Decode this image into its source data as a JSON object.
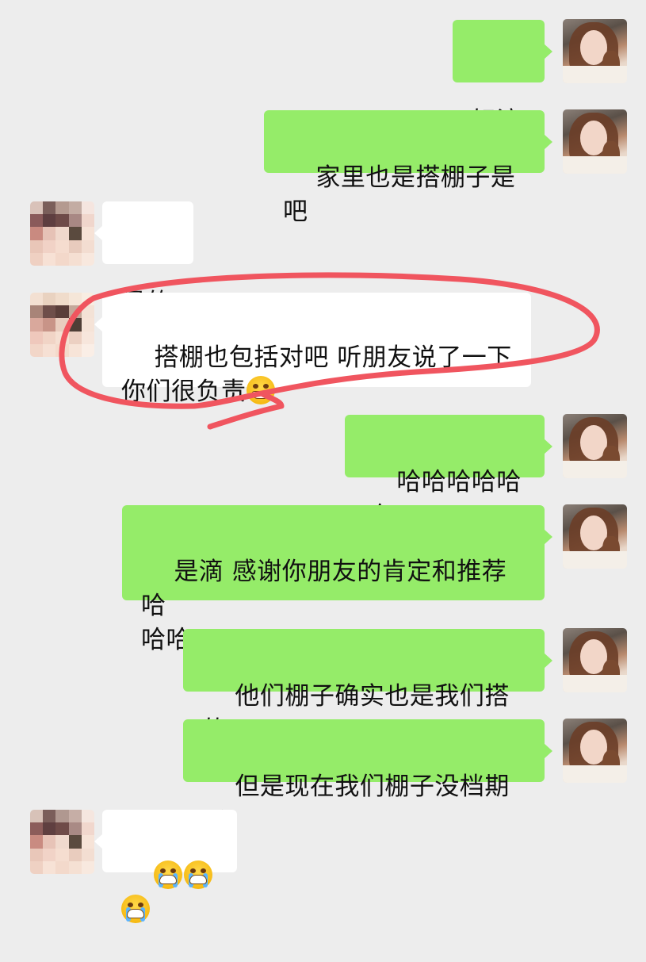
{
  "messages": [
    {
      "side": "sent",
      "text": "好滴"
    },
    {
      "side": "sent",
      "text": "家里也是搭棚子是吧"
    },
    {
      "side": "recv",
      "text": "是的"
    },
    {
      "side": "recv",
      "text": "搭棚也包括对吧 听朋友说了一下\n你们很负责",
      "emoji": "grinning-teeth-emoji",
      "highlighted": true
    },
    {
      "side": "sent",
      "text": "哈哈哈哈哈哈"
    },
    {
      "side": "sent",
      "text": "是滴 感谢你朋友的肯定和推荐哈\n哈哈"
    },
    {
      "side": "sent",
      "text": "他们棚子确实也是我们搭的"
    },
    {
      "side": "sent",
      "text": "但是现在我们棚子没档期了"
    },
    {
      "side": "recv",
      "text": "",
      "emoji": "crying-emoji",
      "emoji_count": 3
    }
  ],
  "colors": {
    "background": "#ededed",
    "sent_bubble": "#95ec69",
    "received_bubble": "#ffffff",
    "highlight_stroke": "#f0555f"
  },
  "icons": {
    "my_avatar": "user-avatar-photo",
    "contact_avatar": "pixelated-avatar"
  }
}
